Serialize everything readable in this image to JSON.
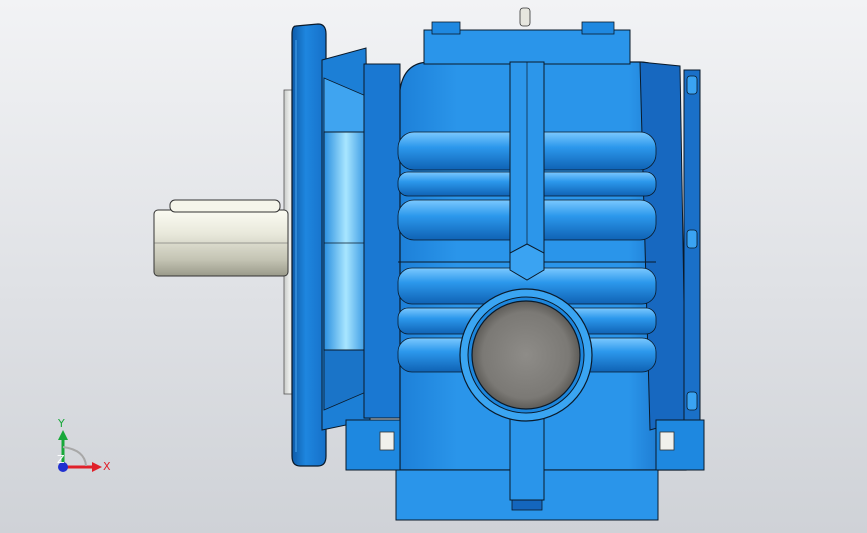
{
  "window": {
    "background_top": "#f2f3f5",
    "background_bottom": "#cfd2d7"
  },
  "model": {
    "body_color": "#1e90e6",
    "body_dark": "#0f5fb0",
    "body_light": "#5ab8f5",
    "shaft_color": "#e8e8dc",
    "bore_color": "#8a8884",
    "outline_color": "#0a1a2a"
  },
  "triad": {
    "x_label": "X",
    "y_label": "Y",
    "z_label": "Z",
    "x_color": "#e0202a",
    "y_color": "#18a83a",
    "z_color": "#2030d0"
  }
}
